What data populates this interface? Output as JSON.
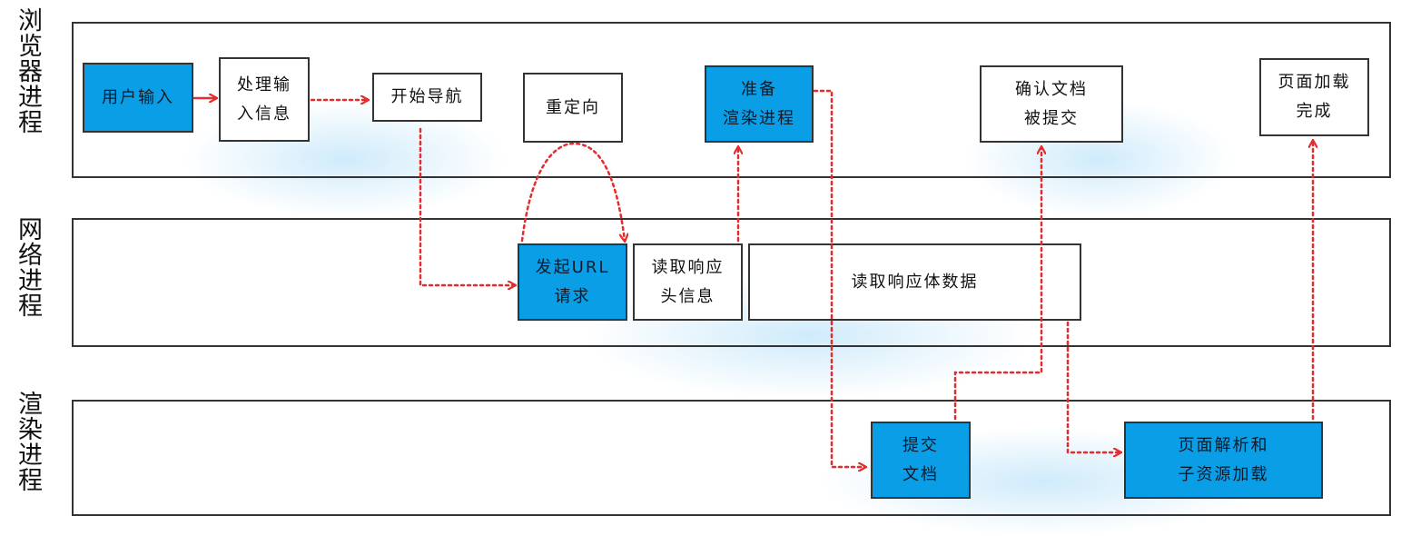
{
  "lanes": {
    "browser": {
      "label": "浏览器进程"
    },
    "network": {
      "label": "网络进程"
    },
    "renderer": {
      "label": "渲染进程"
    }
  },
  "nodes": {
    "user_input": "用户输入",
    "process_input": "处理输\n入信息",
    "start_navigation": "开始导航",
    "redirect": "重定向",
    "prepare_renderer": "准备\n渲染进程",
    "confirm_document": "确认文档\n被提交",
    "page_load_complete": "页面加载\n完成",
    "send_url_request": "发起URL\n请求",
    "read_response_headers": "读取响应\n头信息",
    "read_response_body": "读取响应体数据",
    "commit_document": "提交\n文档",
    "parse_page": "页面解析和\n子资源加载"
  },
  "colors": {
    "active_fill": "#0a9ee6",
    "arrow": "#e52b2b",
    "border": "#333333"
  }
}
